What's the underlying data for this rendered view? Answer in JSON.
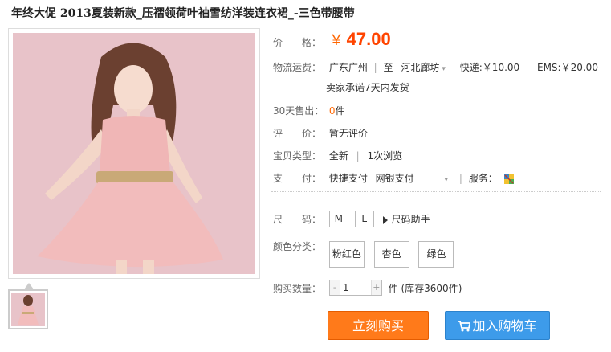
{
  "title": "年终大促 2013夏装新款_压褶领荷叶袖雪纺洋装连衣裙_-三色带腰带",
  "price": {
    "label": "价　　格：",
    "symbol": "￥",
    "value": "47.00"
  },
  "shipping": {
    "label": "物流运费：",
    "from": "广东广州",
    "separator": "|",
    "to_label": "至",
    "to": "河北廊坊",
    "express": "快递:￥10.00",
    "ems": "EMS:￥20.00",
    "promise": "卖家承诺7天内发货"
  },
  "sold": {
    "label": "30天售出：",
    "count": "0",
    "unit": "件"
  },
  "review": {
    "label": "评　　价：",
    "value": "暂无评价"
  },
  "item_type": {
    "label": "宝贝类型：",
    "condition": "全新",
    "views": "1次浏览"
  },
  "payment": {
    "label": "支　　付：",
    "methods": [
      "快捷支付",
      "网银支付"
    ],
    "service_label": "服务："
  },
  "size": {
    "label": "尺　　码：",
    "options": [
      "M",
      "L"
    ],
    "helper": "尺码助手"
  },
  "color": {
    "label": "颜色分类：",
    "options": [
      "粉红色",
      "杏色",
      "绿色"
    ]
  },
  "quantity": {
    "label": "购买数量：",
    "value": "1",
    "stock": "件 (库存3600件)"
  },
  "buttons": {
    "buy_now": "立刻购买",
    "add_cart": "加入购物车"
  },
  "colors": {
    "price": "#ff4400",
    "buy": "#ff7a1a",
    "cart": "#3d9bea"
  }
}
